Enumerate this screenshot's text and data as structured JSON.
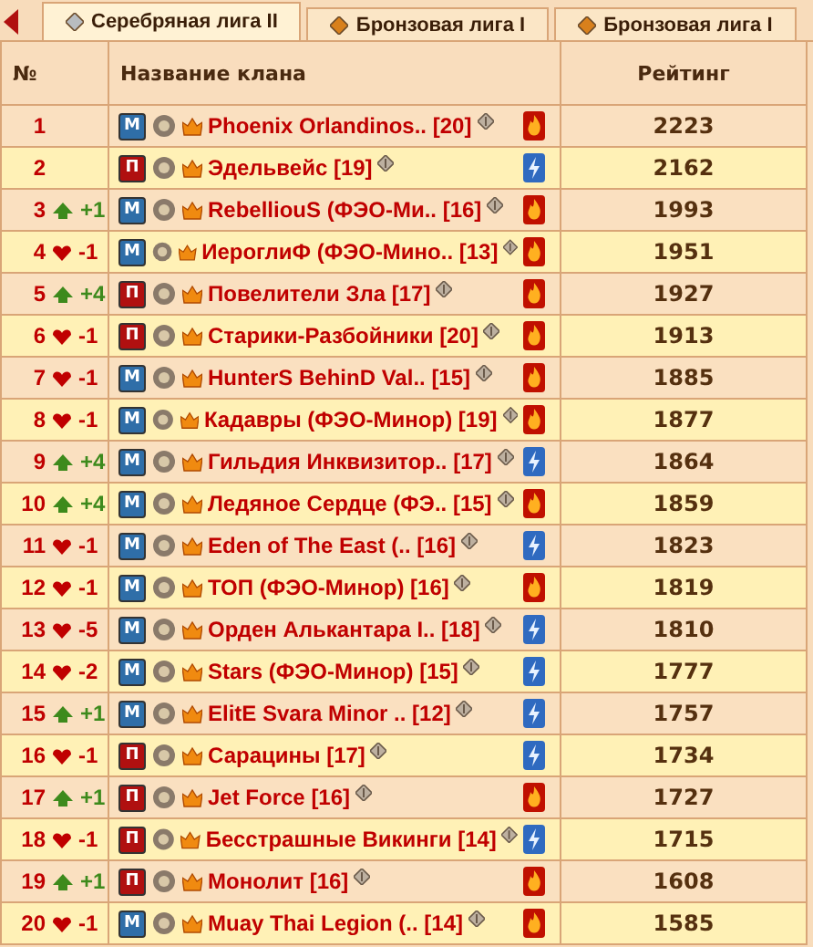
{
  "tabs": [
    {
      "label": "Серебряная лига II",
      "kind": "silver",
      "selected": true
    },
    {
      "label": "Бронзовая лига I",
      "kind": "bronze",
      "selected": false
    },
    {
      "label": "Бронзовая лига I",
      "kind": "bronze",
      "selected": false
    }
  ],
  "table": {
    "columns": [
      "№",
      "Название клана",
      "Рейтинг"
    ],
    "rows": [
      {
        "rank": "1",
        "badge": {
          "text": "М",
          "color": "#2f6ea8"
        },
        "name": "Phoenix Orlandinos.. [20]",
        "element": {
          "kind": "fire"
        },
        "rating": "2223"
      },
      {
        "rank": "2",
        "badge": {
          "text": "П",
          "color": "#b01010"
        },
        "name": "Эдельвейс [19]",
        "element": {
          "kind": "lightning"
        },
        "rating": "2162"
      },
      {
        "rank": "3",
        "change": {
          "kind": "up",
          "text": "+1"
        },
        "badge": {
          "text": "М",
          "color": "#2f6ea8"
        },
        "name": "RebelliouS (ФЭО-Ми.. [16]",
        "element": {
          "kind": "fire"
        },
        "rating": "1993"
      },
      {
        "rank": "4",
        "change": {
          "kind": "down",
          "text": "-1"
        },
        "badge": {
          "text": "М",
          "color": "#2f6ea8"
        },
        "name": "ИероглиФ (ФЭО-Мино.. [13]",
        "element": {
          "kind": "fire"
        },
        "rating": "1951"
      },
      {
        "rank": "5",
        "change": {
          "kind": "up",
          "text": "+4"
        },
        "badge": {
          "text": "П",
          "color": "#b01010"
        },
        "name": "Повелители Зла [17]",
        "element": {
          "kind": "fire"
        },
        "rating": "1927"
      },
      {
        "rank": "6",
        "change": {
          "kind": "down",
          "text": "-1"
        },
        "badge": {
          "text": "П",
          "color": "#b01010"
        },
        "name": "Старики-Разбойники [20]",
        "element": {
          "kind": "fire"
        },
        "rating": "1913"
      },
      {
        "rank": "7",
        "change": {
          "kind": "down",
          "text": "-1"
        },
        "badge": {
          "text": "М",
          "color": "#2f6ea8"
        },
        "name": "HunterS BehinD Val.. [15]",
        "element": {
          "kind": "fire"
        },
        "rating": "1885"
      },
      {
        "rank": "8",
        "change": {
          "kind": "down",
          "text": "-1"
        },
        "badge": {
          "text": "М",
          "color": "#2f6ea8"
        },
        "name": "Кадавры (ФЭО-Минор) [19]",
        "element": {
          "kind": "fire"
        },
        "rating": "1877"
      },
      {
        "rank": "9",
        "change": {
          "kind": "up",
          "text": "+4"
        },
        "badge": {
          "text": "М",
          "color": "#2f6ea8"
        },
        "name": "Гильдия Инквизитор.. [17]",
        "element": {
          "kind": "lightning"
        },
        "rating": "1864"
      },
      {
        "rank": "10",
        "change": {
          "kind": "up",
          "text": "+4"
        },
        "badge": {
          "text": "М",
          "color": "#2f6ea8"
        },
        "name": "Ледяное Сердце (ФЭ.. [15]",
        "element": {
          "kind": "fire"
        },
        "rating": "1859"
      },
      {
        "rank": "11",
        "change": {
          "kind": "down",
          "text": "-1"
        },
        "badge": {
          "text": "М",
          "color": "#2f6ea8"
        },
        "name": "Eden of The East (.. [16]",
        "element": {
          "kind": "lightning"
        },
        "rating": "1823"
      },
      {
        "rank": "12",
        "change": {
          "kind": "down",
          "text": "-1"
        },
        "badge": {
          "text": "М",
          "color": "#2f6ea8"
        },
        "name": "ТОП (ФЭО-Минор) [16]",
        "element": {
          "kind": "fire"
        },
        "rating": "1819"
      },
      {
        "rank": "13",
        "change": {
          "kind": "down",
          "text": "-5"
        },
        "badge": {
          "text": "М",
          "color": "#2f6ea8"
        },
        "name": "Орден Алькантара I.. [18]",
        "element": {
          "kind": "lightning"
        },
        "rating": "1810"
      },
      {
        "rank": "14",
        "change": {
          "kind": "down",
          "text": "-2"
        },
        "badge": {
          "text": "М",
          "color": "#2f6ea8"
        },
        "name": "Stars (ФЭО-Минор) [15]",
        "element": {
          "kind": "lightning"
        },
        "rating": "1777"
      },
      {
        "rank": "15",
        "change": {
          "kind": "up",
          "text": "+1"
        },
        "badge": {
          "text": "М",
          "color": "#2f6ea8"
        },
        "name": "ElitE Svara Minor .. [12]",
        "element": {
          "kind": "lightning"
        },
        "rating": "1757"
      },
      {
        "rank": "16",
        "change": {
          "kind": "down",
          "text": "-1"
        },
        "badge": {
          "text": "П",
          "color": "#b01010"
        },
        "name": "Сарацины [17]",
        "element": {
          "kind": "lightning"
        },
        "rating": "1734"
      },
      {
        "rank": "17",
        "change": {
          "kind": "up",
          "text": "+1"
        },
        "badge": {
          "text": "П",
          "color": "#b01010"
        },
        "name": "Jet Force [16]",
        "element": {
          "kind": "fire"
        },
        "rating": "1727"
      },
      {
        "rank": "18",
        "change": {
          "kind": "down",
          "text": "-1"
        },
        "badge": {
          "text": "П",
          "color": "#b01010"
        },
        "name": "Бесстрашные Викинги [14]",
        "element": {
          "kind": "lightning"
        },
        "rating": "1715"
      },
      {
        "rank": "19",
        "change": {
          "kind": "up",
          "text": "+1"
        },
        "badge": {
          "text": "П",
          "color": "#b01010"
        },
        "name": "Монолит [16]",
        "element": {
          "kind": "fire"
        },
        "rating": "1608"
      },
      {
        "rank": "20",
        "change": {
          "kind": "down",
          "text": "-1"
        },
        "badge": {
          "text": "М",
          "color": "#2f6ea8"
        },
        "name": "Muay Thai Legion (.. [14]",
        "element": {
          "kind": "fire"
        },
        "rating": "1585"
      }
    ]
  }
}
